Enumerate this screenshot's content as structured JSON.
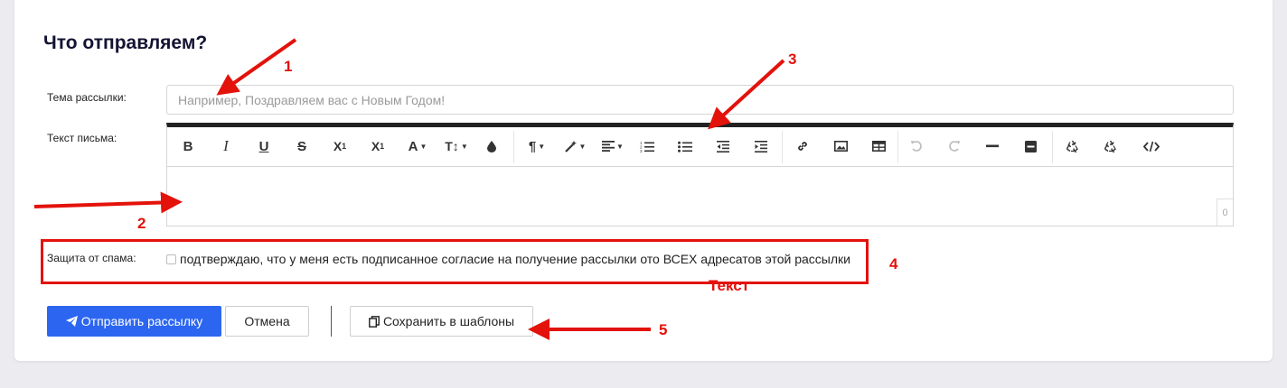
{
  "form": {
    "title": "Что отправляем?",
    "subject_label": "Тема рассылки:",
    "subject_placeholder": "Например, Поздравляем вас с Новым Годом!",
    "subject_value": "",
    "body_label": "Текст письма:",
    "char_counter": "0",
    "spam_label": "Защита от спама:",
    "consent_text": "подтверждаю, что у меня есть подписанное согласие на получение рассылки ото ВСЕХ адресатов этой рассылки",
    "consent_checked": false
  },
  "toolbar": {
    "buttons": [
      {
        "name": "bold-icon",
        "glyph": "B"
      },
      {
        "name": "italic-icon",
        "glyph": "I"
      },
      {
        "name": "underline-icon",
        "glyph": "U"
      },
      {
        "name": "strikethrough-icon",
        "glyph": "S"
      },
      {
        "name": "subscript-icon",
        "glyph": "X₁"
      },
      {
        "name": "superscript-icon",
        "glyph": "X¹"
      },
      {
        "name": "font-color-icon",
        "glyph": "A"
      },
      {
        "name": "font-size-icon",
        "glyph": "T↕"
      },
      {
        "name": "ink-drop-icon",
        "glyph": "drop"
      },
      {
        "name": "paragraph-icon",
        "glyph": "¶"
      },
      {
        "name": "magic-wand-icon",
        "glyph": "wand"
      },
      {
        "name": "align-icon",
        "glyph": "align"
      },
      {
        "name": "ordered-list-icon",
        "glyph": "ol"
      },
      {
        "name": "unordered-list-icon",
        "glyph": "ul"
      },
      {
        "name": "outdent-icon",
        "glyph": "outdent"
      },
      {
        "name": "indent-icon",
        "glyph": "indent"
      },
      {
        "name": "link-icon",
        "glyph": "link"
      },
      {
        "name": "image-icon",
        "glyph": "image"
      },
      {
        "name": "table-icon",
        "glyph": "table"
      },
      {
        "name": "undo-icon",
        "glyph": "undo"
      },
      {
        "name": "redo-icon",
        "glyph": "redo"
      },
      {
        "name": "horizontal-rule-icon",
        "glyph": "hr"
      },
      {
        "name": "block-icon",
        "glyph": "block"
      },
      {
        "name": "recycle-icon",
        "glyph": "recycle"
      },
      {
        "name": "recycle-icon-2",
        "glyph": "recycle"
      },
      {
        "name": "code-icon",
        "glyph": "code"
      }
    ]
  },
  "actions": {
    "send_label": "Отправить рассылку",
    "cancel_label": "Отмена",
    "save_template_label": "Сохранить в шаблоны"
  },
  "annotations": {
    "n1": "1",
    "n2": "2",
    "n3": "3",
    "n4": "4",
    "n5": "5",
    "overlap_text": "Текст"
  },
  "colors": {
    "primary": "#2c66f0",
    "annotation_red": "#e3120b",
    "title_color": "#131332"
  }
}
